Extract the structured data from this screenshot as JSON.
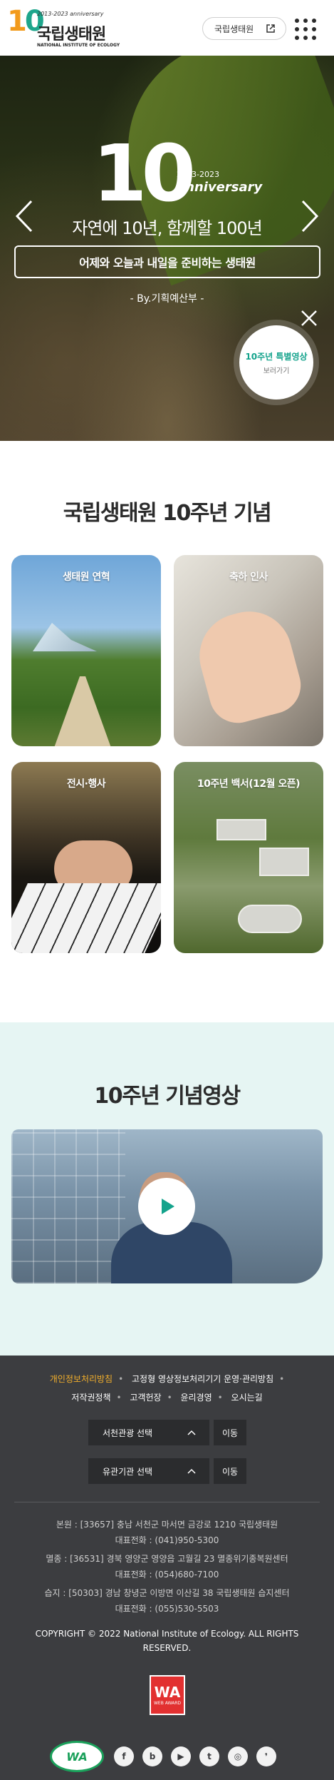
{
  "header": {
    "logo": {
      "years": "2013-2023 anniversary",
      "name_kr": "국립생태원",
      "name_en": "NATIONAL INSTITUTE OF ECOLOGY"
    },
    "site_button": "국립생태원"
  },
  "hero": {
    "years": "2013-2023",
    "anniversary": "anniversary",
    "title": "자연에 10년, 함께할 100년",
    "box_text": "어제와 오늘과 내일을 준비하는 생태원",
    "by_line": "- By.기획예산부 -",
    "special": {
      "title": "10주년 특별영상",
      "sub": "보러가기"
    }
  },
  "anniversary_section": {
    "title": "국립생태원 10주년 기념",
    "cards": [
      {
        "label": "생태원 연혁"
      },
      {
        "label": "축하 인사"
      },
      {
        "label": "전시·행사"
      },
      {
        "label": "10주년 백서(12월 오픈)"
      }
    ]
  },
  "video_section": {
    "title": "10주년 기념영상"
  },
  "footer": {
    "links": [
      "개인정보처리방침",
      "고정형 영상정보처리기기 운영·관리방침",
      "저작권정책",
      "고객헌장",
      "윤리경영",
      "오시는길"
    ],
    "select1": "서천관광 선택",
    "select2": "유관기관 선택",
    "go_label": "이동",
    "addresses": {
      "main": "본원 : [33657] 충남 서천군 마서면 금강로 1210 국립생태원",
      "main_tel": "대표전화 : (041)950-5300",
      "yeongyang": "멸종 : [36531] 경북 영양군 영양읍 고월길 23 멸종위기종복원센터",
      "yeongyang_tel": "대표전화 : (054)680-7100",
      "wetland": "습지 : [50303] 경남 창녕군 이방면 이산길 38 국립생태원 습지센터",
      "wetland_tel": "대표전화 : (055)530-5503"
    },
    "copyright": "COPYRIGHT © 2022 National Institute of Ecology. ALL RIGHTS RESERVED.",
    "award": {
      "mark": "WA",
      "text": "WEB AWARD"
    },
    "wa_badge": "WA",
    "social": [
      "f",
      "b",
      "▶",
      "t",
      "◎",
      "❜"
    ]
  },
  "colors": {
    "accent_teal": "#14a38c",
    "accent_orange": "#f4b02b",
    "footer_bg": "#3c3d40",
    "video_bg": "#e6f5f3"
  },
  "icons": [
    "external-link-icon",
    "menu-grid-icon",
    "chevron-left-icon",
    "chevron-right-icon",
    "close-icon",
    "play-icon",
    "chevron-up-icon"
  ]
}
